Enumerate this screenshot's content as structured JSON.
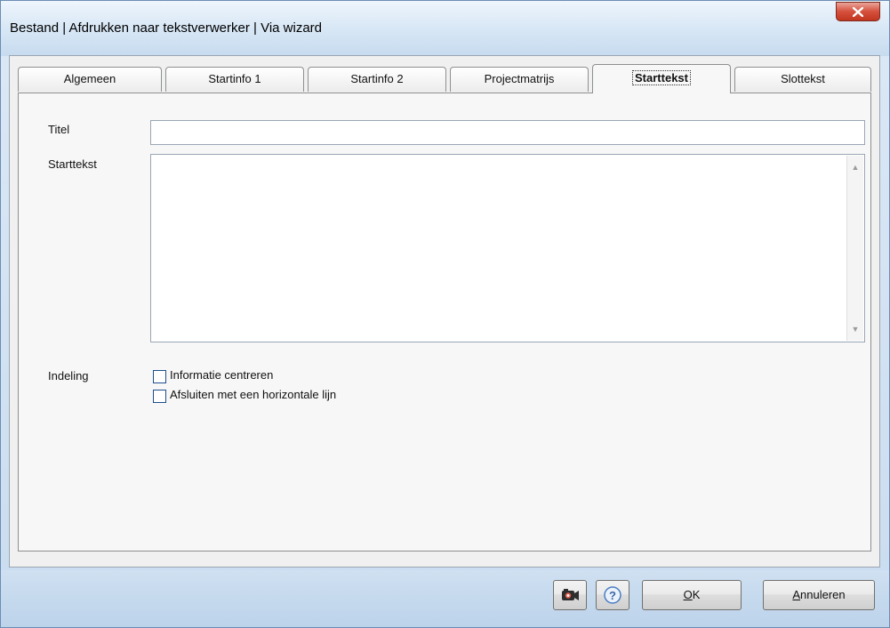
{
  "window": {
    "title": "Bestand | Afdrukken naar tekstverwerker | Via wizard",
    "close_icon": "close-icon",
    "close_color": "#c9402b"
  },
  "tabs": [
    {
      "label": "Algemeen",
      "active": false
    },
    {
      "label": "Startinfo 1",
      "active": false
    },
    {
      "label": "Startinfo 2",
      "active": false
    },
    {
      "label": "Projectmatrijs",
      "active": false
    },
    {
      "label": "Starttekst",
      "active": true
    },
    {
      "label": "Slottekst",
      "active": false
    }
  ],
  "form": {
    "titel_label": "Titel",
    "titel_value": "",
    "starttekst_label": "Starttekst",
    "starttekst_value": "",
    "indeling_label": "Indeling",
    "options": [
      {
        "label": "Informatie centreren",
        "checked": false
      },
      {
        "label": "Afsluiten met een horizontale lijn",
        "checked": false
      }
    ]
  },
  "buttons": {
    "camera_icon": "camera-icon",
    "help_icon": "help-icon",
    "ok_label": "OK",
    "ok_mnemonic": "O",
    "cancel_label": "Annuleren",
    "cancel_mnemonic": "A"
  }
}
